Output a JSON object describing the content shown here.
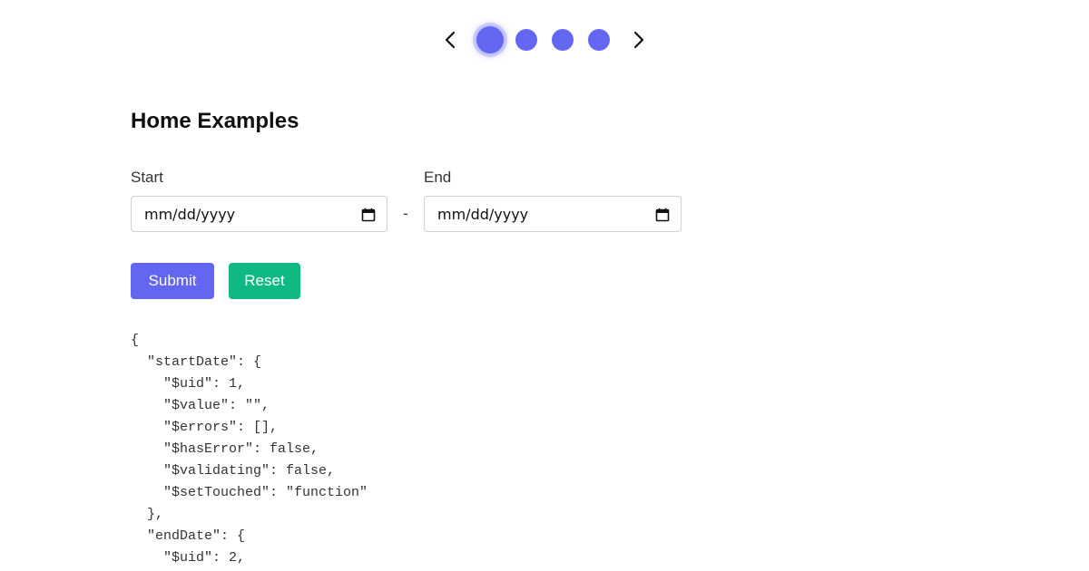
{
  "colors": {
    "accent": "#6366f1",
    "reset": "#10b981",
    "text": "#111111"
  },
  "pager": {
    "prev_icon": "chevron-left-icon",
    "next_icon": "chevron-right-icon",
    "dot_count": 4,
    "active_index": 0
  },
  "page": {
    "title": "Home Examples"
  },
  "form": {
    "start_label": "Start",
    "end_label": "End",
    "start_value": "mm/dd/yyyy",
    "end_value": "mm/dd/yyyy",
    "separator": "-",
    "calendar_icon": "calendar-icon",
    "submit_label": "Submit",
    "reset_label": "Reset"
  },
  "json_output": {
    "lines": [
      "{",
      "  \"startDate\": {",
      "    \"$uid\": 1,",
      "    \"$value\": \"\",",
      "    \"$errors\": [],",
      "    \"$hasError\": false,",
      "    \"$validating\": false,",
      "    \"$setTouched\": \"function\"",
      "  },",
      "  \"endDate\": {",
      "    \"$uid\": 2,"
    ]
  }
}
